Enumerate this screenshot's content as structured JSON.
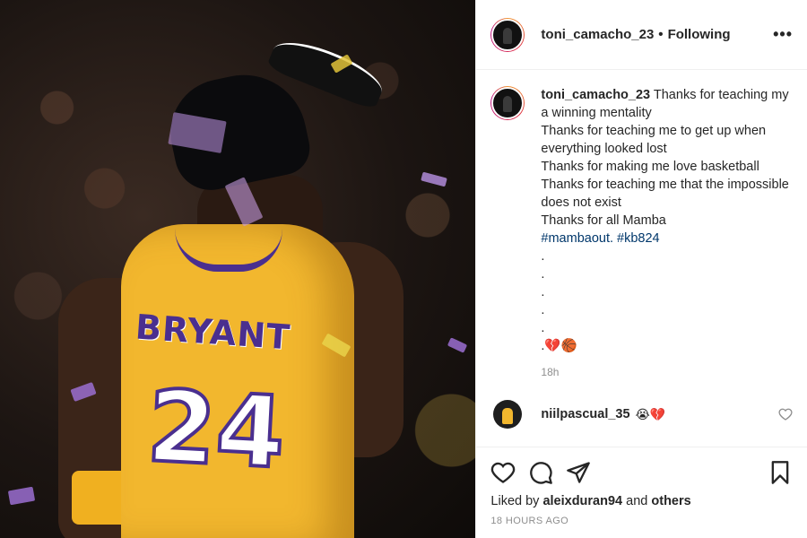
{
  "header": {
    "username": "toni_camacho_23",
    "separator": "•",
    "follow_status": "Following",
    "more_label": "•••"
  },
  "caption": {
    "username": "toni_camacho_23",
    "lines": [
      "Thanks for teaching my a winning mentality",
      "Thanks for teaching me to get up when everything looked lost",
      "Thanks for making me love basketball",
      "Thanks for teaching me that the impossible does not exist",
      "Thanks for all Mamba"
    ],
    "hashtags": "#mambaout. #kb824",
    "dots": [
      ".",
      ".",
      ".",
      ".",
      "."
    ],
    "emoji_line": ".💔🏀",
    "time": "18h"
  },
  "comment": {
    "username": "niilpascual_35",
    "text": "😭💔"
  },
  "photo": {
    "jersey_name": "BRYANT",
    "jersey_number": "24"
  },
  "footer": {
    "liked_prefix": "Liked by",
    "liked_user": "aleixduran94",
    "liked_middle": "and",
    "liked_others": "others",
    "timestamp": "18 HOURS AGO"
  },
  "colors": {
    "jersey_gold": "#f2b72e",
    "jersey_purple": "#4a2f8f",
    "hashtag_blue": "#00376b",
    "muted_gray": "#8e8e8e"
  },
  "icons": [
    "heart-icon",
    "comment-icon",
    "share-icon",
    "bookmark-icon",
    "more-icon"
  ]
}
